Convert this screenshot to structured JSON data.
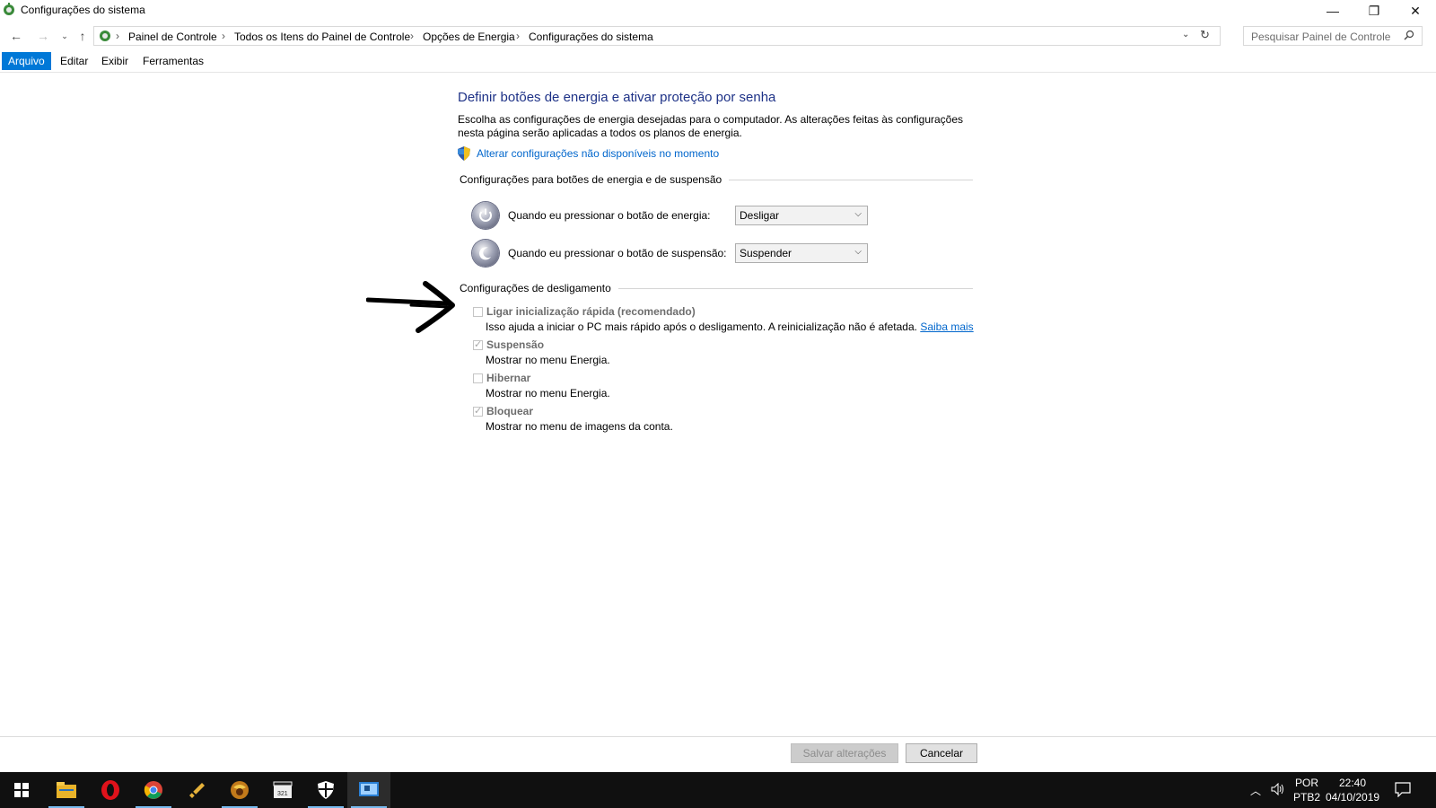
{
  "window": {
    "title": "Configurações do sistema",
    "controls": {
      "minimize": "—",
      "restore": "❐",
      "close": "✕"
    }
  },
  "address_bar": {
    "breadcrumbs": [
      "Painel de Controle",
      "Todos os Itens do Painel de Controle",
      "Opções de Energia",
      "Configurações do sistema"
    ],
    "search_placeholder": "Pesquisar Painel de Controle"
  },
  "menu": {
    "items": [
      "Arquivo",
      "Editar",
      "Exibir",
      "Ferramentas"
    ]
  },
  "page": {
    "heading": "Definir botões de energia e ativar proteção por senha",
    "intro": "Escolha as configurações de energia desejadas para o computador. As alterações feitas às configurações nesta página serão aplicadas a todos os planos de energia.",
    "change_link": "Alterar configurações não disponíveis no momento",
    "power_section": {
      "title": "Configurações para botões de energia e de suspensão",
      "power_button_label": "Quando eu pressionar o botão de energia:",
      "power_button_value": "Desligar",
      "sleep_button_label": "Quando eu pressionar o botão de suspensão:",
      "sleep_button_value": "Suspender"
    },
    "shutdown_section": {
      "title": "Configurações de desligamento",
      "options": [
        {
          "label": "Ligar inicialização rápida (recomendado)",
          "desc": "Isso ajuda a iniciar o PC mais rápido após o desligamento. A reinicialização não é afetada.",
          "link": "Saiba mais",
          "checked": false
        },
        {
          "label": "Suspensão",
          "desc": "Mostrar no menu Energia.",
          "checked": true
        },
        {
          "label": "Hibernar",
          "desc": "Mostrar no menu Energia.",
          "checked": false
        },
        {
          "label": "Bloquear",
          "desc": "Mostrar no menu de imagens da conta.",
          "checked": true
        }
      ]
    }
  },
  "footer": {
    "save_label": "Salvar alterações",
    "cancel_label": "Cancelar"
  },
  "taskbar": {
    "apps": [
      "start-icon",
      "file-explorer-icon",
      "opera-icon",
      "chrome-icon",
      "app-icon-5",
      "game-icon",
      "video-editor-icon",
      "security-icon",
      "control-panel-icon"
    ],
    "language_top": "POR",
    "language_bottom": "PTB2",
    "time": "22:40",
    "date": "04/10/2019"
  },
  "colors": {
    "accent": "#0078d7",
    "heading": "#1e3287",
    "link": "#0066cc",
    "taskbar": "#101010"
  }
}
